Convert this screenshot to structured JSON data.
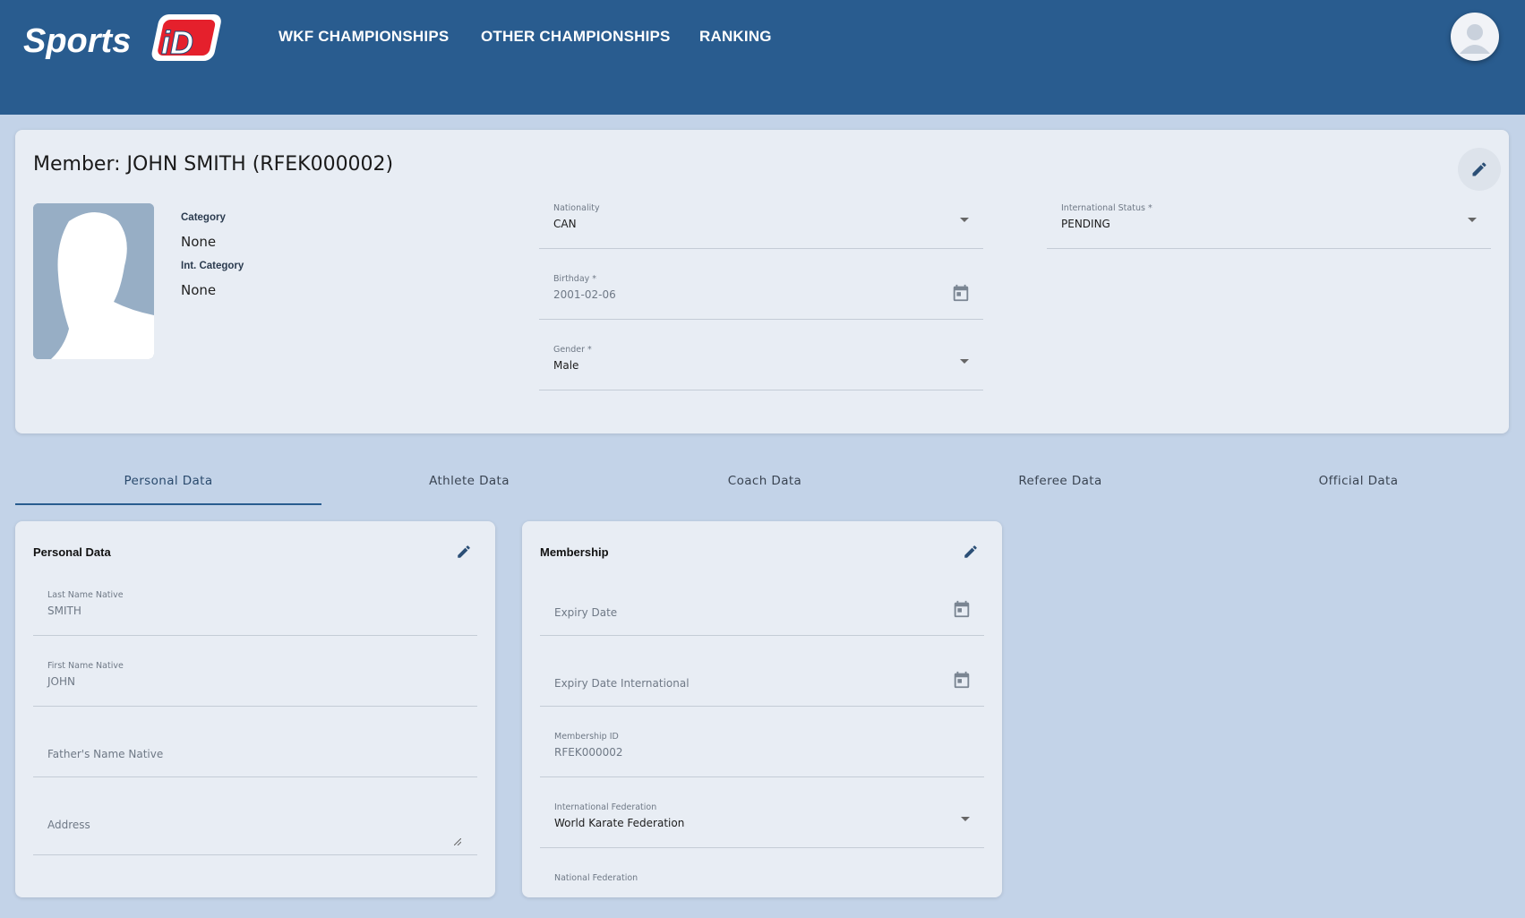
{
  "header": {
    "logo_text": "SportsID",
    "nav": [
      "WKF CHAMPIONSHIPS",
      "OTHER CHAMPIONSHIPS",
      "RANKING"
    ]
  },
  "member": {
    "title": "Member: JOHN SMITH (RFEK000002)",
    "category_label": "Category",
    "category_value": "None",
    "int_category_label": "Int. Category",
    "int_category_value": "None",
    "nationality": {
      "label": "Nationality",
      "value": "CAN"
    },
    "birthday": {
      "label": "Birthday *",
      "value": "2001-02-06"
    },
    "gender": {
      "label": "Gender *",
      "value": "Male"
    },
    "international_status": {
      "label": "International Status *",
      "value": "PENDING"
    }
  },
  "tabs": [
    "Personal Data",
    "Athlete Data",
    "Coach Data",
    "Referee Data",
    "Official Data"
  ],
  "personal_data": {
    "title": "Personal Data",
    "last_name": {
      "label": "Last Name Native",
      "value": "SMITH"
    },
    "first_name": {
      "label": "First Name Native",
      "value": "JOHN"
    },
    "fathers_name": {
      "placeholder": "Father's Name Native"
    },
    "address": {
      "placeholder": "Address"
    }
  },
  "membership": {
    "title": "Membership",
    "expiry_date": {
      "placeholder": "Expiry Date"
    },
    "expiry_date_international": {
      "placeholder": "Expiry Date International"
    },
    "membership_id": {
      "label": "Membership ID",
      "value": "RFEK000002"
    },
    "international_federation": {
      "label": "International Federation",
      "value": "World Karate Federation"
    },
    "national_federation": {
      "label": "National Federation"
    }
  },
  "colors": {
    "header": "#295c8f",
    "background": "#c3d3e8",
    "card": "#e8edf4",
    "logo_red": "#e5202c"
  }
}
